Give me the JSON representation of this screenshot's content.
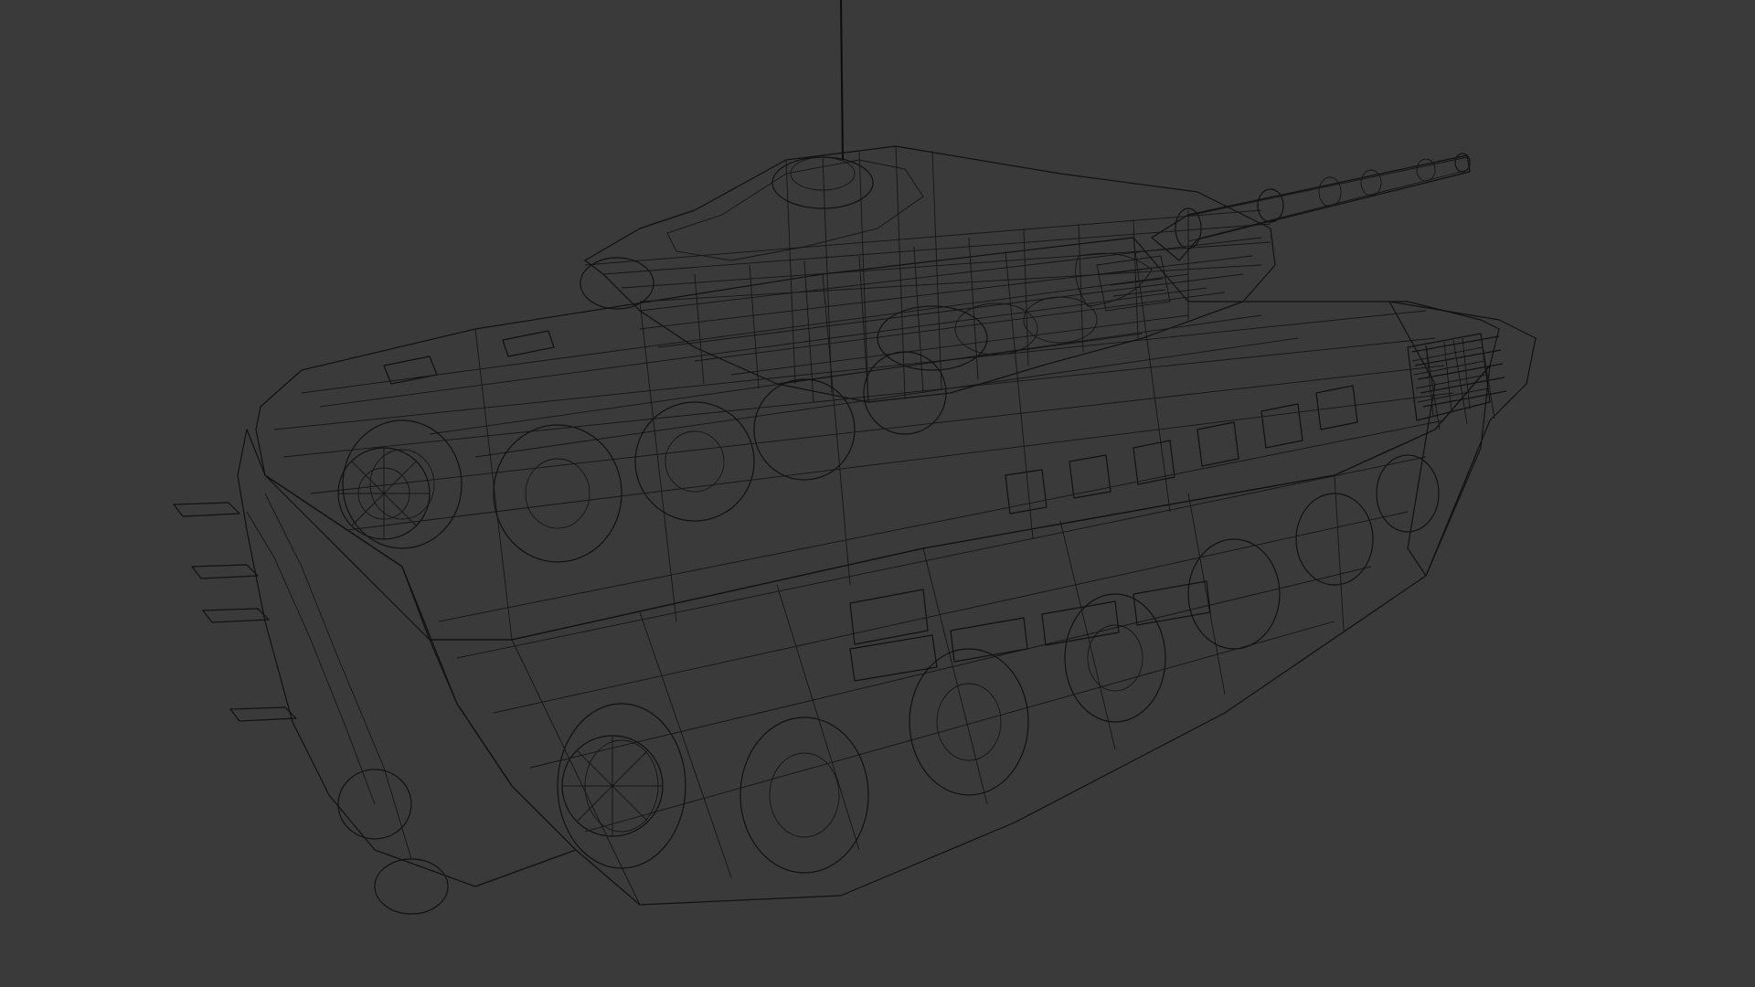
{
  "viewport": {
    "background_color": "#3a3a3a",
    "shaded_fill_color": "#6a6a6a",
    "wire_color": "#111111",
    "render_mode": "wireframe"
  },
  "subject": {
    "icon": "tank-wireframe-icon"
  }
}
